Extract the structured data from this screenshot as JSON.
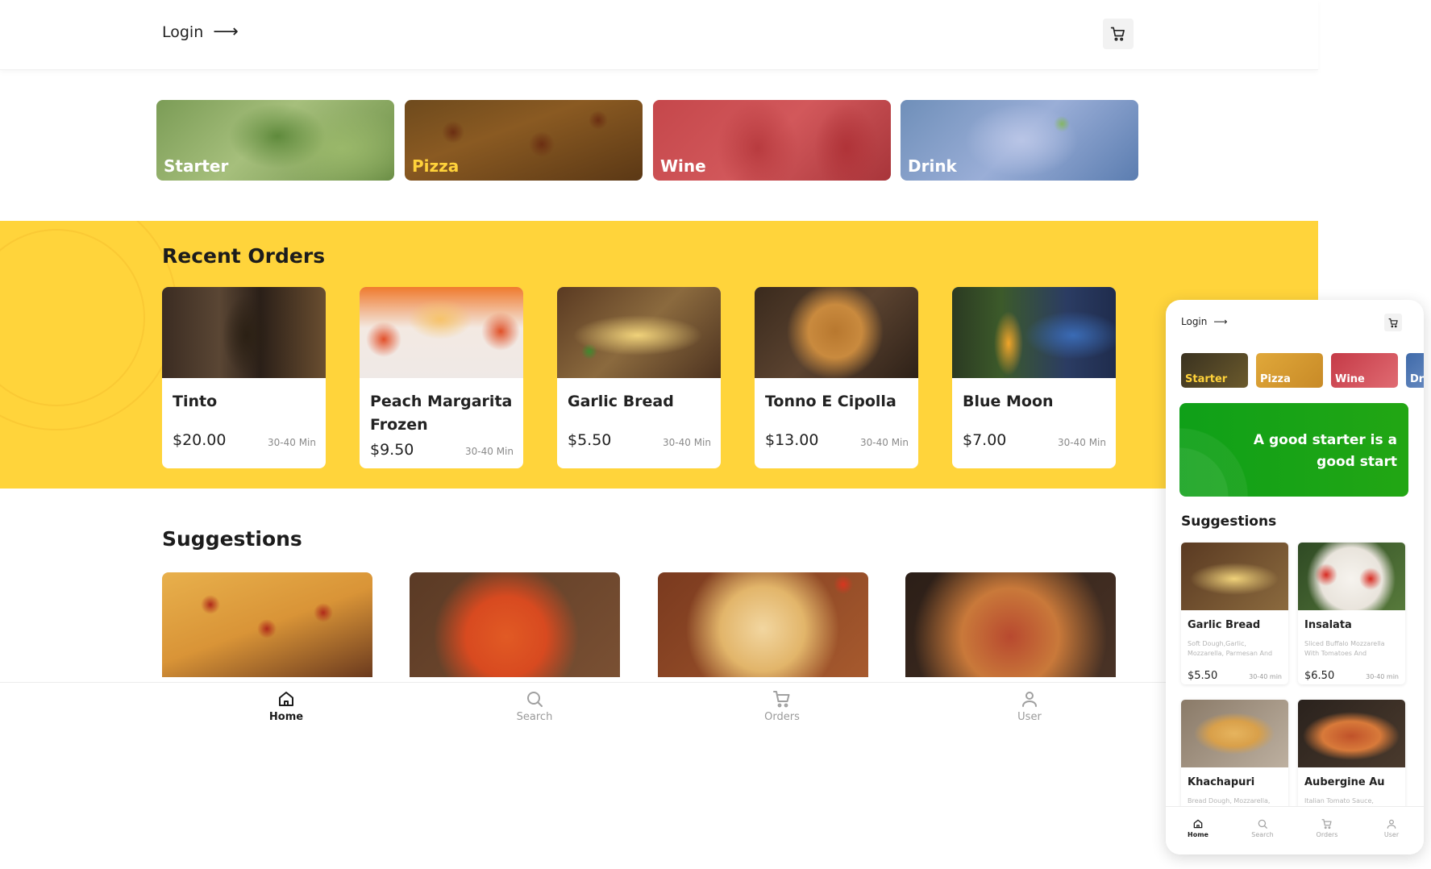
{
  "header": {
    "login_label": "Login",
    "login_arrow": "⟶"
  },
  "categories": [
    {
      "label": "Starter"
    },
    {
      "label": "Pizza"
    },
    {
      "label": "Wine"
    },
    {
      "label": "Drink"
    }
  ],
  "recent_orders": {
    "title": "Recent Orders",
    "items": [
      {
        "name": "Tinto",
        "price": "$20.00",
        "time": "30-40 Min"
      },
      {
        "name": "Peach Margarita Frozen",
        "price": "$9.50",
        "time": "30-40 Min"
      },
      {
        "name": "Garlic Bread",
        "price": "$5.50",
        "time": "30-40 Min"
      },
      {
        "name": "Tonno E Cipolla",
        "price": "$13.00",
        "time": "30-40 Min"
      },
      {
        "name": "Blue Moon",
        "price": "$7.00",
        "time": "30-40 Min"
      }
    ]
  },
  "suggestions": {
    "title": "Suggestions"
  },
  "bottom_nav": [
    {
      "label": "Home",
      "active": true
    },
    {
      "label": "Search"
    },
    {
      "label": "Orders"
    },
    {
      "label": "User"
    }
  ],
  "mobile": {
    "login_label": "Login",
    "login_arrow": "⟶",
    "categories": [
      {
        "label": "Starter"
      },
      {
        "label": "Pizza"
      },
      {
        "label": "Wine"
      },
      {
        "label": "Dri"
      }
    ],
    "banner_text": "A good starter is a good start",
    "suggestions_title": "Suggestions",
    "suggestions": [
      {
        "name": "Garlic Bread",
        "desc": "Soft Dough,Garlic, Mozzarella, Parmesan And",
        "price": "$5.50",
        "time": "30-40 min"
      },
      {
        "name": "Insalata",
        "desc": "Sliced Buffalo Mozzarella With Tomatoes And",
        "price": "$6.50",
        "time": "30-40 min"
      },
      {
        "name": "Khachapuri",
        "desc": "Bread Dough, Mozzarella,",
        "price": "",
        "time": ""
      },
      {
        "name": "Aubergine Au",
        "desc": "Italian Tomato Sauce,",
        "price": "",
        "time": ""
      }
    ],
    "nav": [
      {
        "label": "Home",
        "active": true
      },
      {
        "label": "Search"
      },
      {
        "label": "Orders"
      },
      {
        "label": "User"
      }
    ]
  },
  "colors": {
    "accent_yellow": "#ffd43b",
    "banner_green": "#1aa31a",
    "pizza_label": "#ffd23a"
  },
  "icons": [
    "arrow-right-icon",
    "cart-icon",
    "home-icon",
    "search-icon",
    "orders-cart-icon",
    "user-icon"
  ]
}
